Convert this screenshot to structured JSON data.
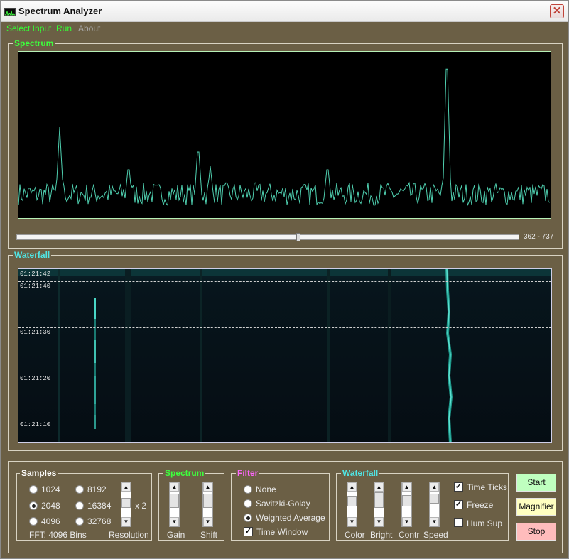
{
  "window": {
    "title": "Spectrum Analyzer",
    "close_glyph": "✕"
  },
  "menu": {
    "items": [
      {
        "label": "Select Input",
        "enabled": true
      },
      {
        "label": "Run",
        "enabled": true
      },
      {
        "label": "About",
        "enabled": false
      }
    ]
  },
  "spectrum_panel": {
    "label": "Spectrum",
    "range_text": "362 - 737",
    "slider_fraction": 0.556
  },
  "waterfall_panel": {
    "label": "Waterfall",
    "time_labels": [
      "01:21:42",
      "01:21:40",
      "01:21:30",
      "01:21:20",
      "01:21:10"
    ]
  },
  "samples": {
    "label": "Samples",
    "options": [
      "1024",
      "8192",
      "2048",
      "16384",
      "4096",
      "32768"
    ],
    "selected": "2048",
    "multiplier": "x 2",
    "fft_text": "FFT: 4096 Bins",
    "resolution_label": "Resolution"
  },
  "spectrum_controls": {
    "label": "Spectrum",
    "gain_label": "Gain",
    "shift_label": "Shift"
  },
  "filter": {
    "label": "Filter",
    "options": [
      "None",
      "Savitzki-Golay",
      "Weighted Average"
    ],
    "selected": "Weighted Average",
    "time_window_label": "Time Window",
    "time_window_checked": true
  },
  "waterfall_controls": {
    "label": "Waterfall",
    "color_label": "Color",
    "bright_label": "Bright",
    "contr_label": "Contr",
    "speed_label": "Speed",
    "time_ticks_label": "Time Ticks",
    "time_ticks_checked": true,
    "freeze_label": "Freeze",
    "freeze_checked": true,
    "hum_sup_label": "Hum Sup",
    "hum_sup_checked": false
  },
  "buttons": {
    "start": "Start",
    "magnifier": "Magnifier",
    "stop": "Stop"
  },
  "colors": {
    "frame_bg": "#6b5f45",
    "spectrum_label": "#3dff3d",
    "spectrum_trace": "#4fd0b0",
    "waterfall_label": "#4fe6e6",
    "filter_label": "#ff66ff",
    "menu_enabled": "#34ff34",
    "start_bg": "#bfffbf",
    "magnifier_bg": "#ffffc0",
    "stop_bg": "#ffbcbc"
  }
}
